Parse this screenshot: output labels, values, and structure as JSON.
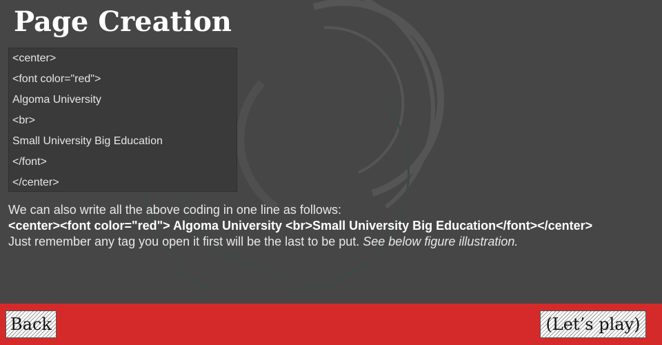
{
  "page": {
    "title": "Page Creation"
  },
  "code_box": {
    "lines": [
      "<center>",
      "<font color=\"red\">",
      "Algoma University",
      "<br>",
      "Small University Big Education",
      "</font>",
      "</center>"
    ]
  },
  "explanation": {
    "line1": "We can also write all the above coding in one line as follows:",
    "line2": "<center><font color=\"red\"> Algoma University <br>Small University Big Education</font></center>",
    "line3": "Just remember any tag you open it first will be the last to be put. ",
    "line3_italic": "See below figure illustration."
  },
  "footer": {
    "back_label": "Back",
    "play_label": "(Let’s play)"
  },
  "colors": {
    "background": "#464646",
    "footer_red": "#d52a2a",
    "text": "#e8e8e8"
  }
}
